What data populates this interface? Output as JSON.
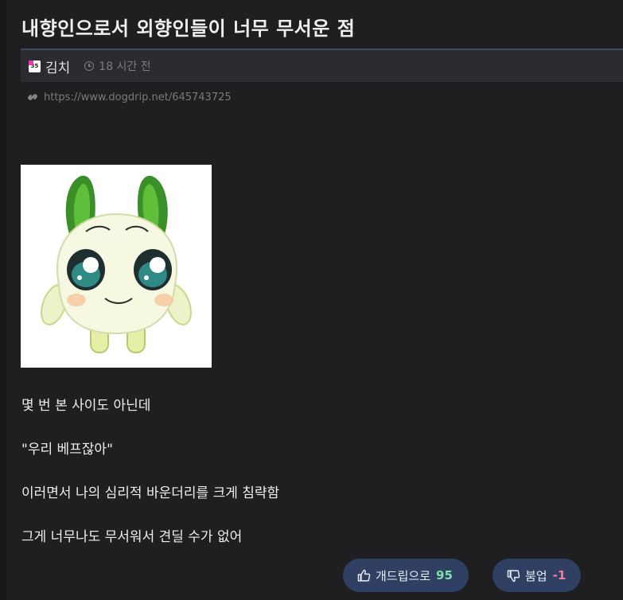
{
  "post": {
    "title": "내향인으로서 외향인들이 너무 무서운 점",
    "author": "김치",
    "avatar_badge": "35",
    "timestamp": "18 시간 전",
    "url": "https://www.dogdrip.net/645743725",
    "image_alt": "cute green-eared character illustration",
    "lines": [
      "몇 번 본 사이도 아닌데",
      "\"우리 베프잖아\"",
      "이러면서 나의 심리적 바운더리를 크게 침략함",
      "그게 너무나도 무서워서 견딜 수가 없어"
    ]
  },
  "votes": {
    "up_label": "개드립으로",
    "up_count": "95",
    "up_icon": "thumbs-up-icon",
    "up_color": "#7ee0a8",
    "down_label": "붐업",
    "down_count": "-1",
    "down_icon": "thumbs-down-icon",
    "down_color": "#f47ba0"
  },
  "theme": {
    "background": "#1f1f21",
    "meta_bar": "#2c2c30",
    "button": "#2f4063"
  }
}
